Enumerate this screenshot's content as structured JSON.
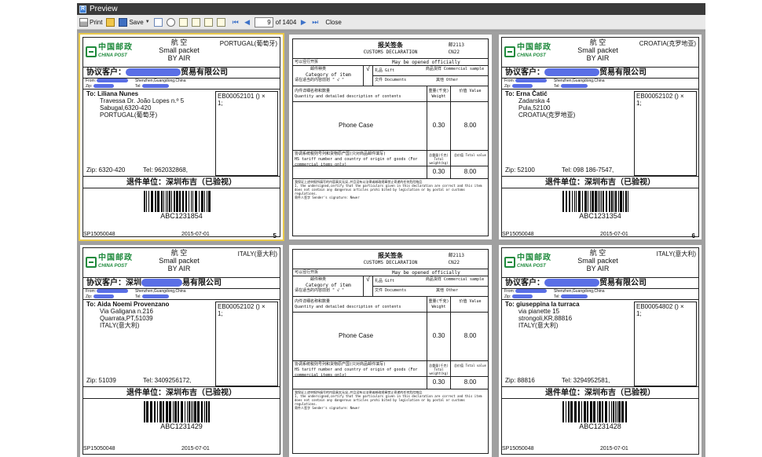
{
  "window": {
    "title": "Preview"
  },
  "toolbar": {
    "print_label": "Print",
    "save_label": "Save",
    "page_value": "9",
    "page_total": "of 1404",
    "close_label": "Close"
  },
  "labels": [
    {
      "header_cn": "航 空",
      "header_en1": "Small packet",
      "header_en2": "BY AIR",
      "logo_cn": "中国邮政",
      "logo_en": "CHINA POST",
      "destination_tag": "PORTUGAL(葡萄牙)",
      "customer_prefix": "协议客户：",
      "customer_suffix": "贸易有限公司",
      "from_label": "From:",
      "from_address": "Shenzhen,Guangdong,China",
      "zip_label_small": "Zip:",
      "tel_label_small": "Tel:",
      "to_label": "To:",
      "to_name": "Liliana Nunes",
      "to_line1": "Travessa Dr. João Lopes n.º 5",
      "to_line2": "Sabugal,6320-420",
      "to_line3": "PORTUGAL(葡萄牙)",
      "tracking": "EB00052101 () ×",
      "qty": "1;",
      "zip": "Zip:  6320-420",
      "tel": "Tel: 962032868,",
      "return_unit": "退件单位：深圳布吉（已验视）",
      "barcode_text": "ABC1231854",
      "sp_code": "SP15050048",
      "date": "2015-07-01",
      "page_number": "5"
    },
    {
      "header_cn": "航 空",
      "header_en1": "Small packet",
      "header_en2": "BY AIR",
      "logo_cn": "中国邮政",
      "logo_en": "CHINA POST",
      "destination_tag": "CROATIA(克罗地亚)",
      "customer_prefix": "协议客户：",
      "customer_suffix": "贸易有限公司",
      "from_label": "From:",
      "from_address": "Shenzhen,Guangdong,China",
      "zip_label_small": "Zip:",
      "tel_label_small": "Tel:",
      "to_label": "To:",
      "to_name": "Erna Čatić",
      "to_line1": "Zadarska 4",
      "to_line2": "Pula,52100",
      "to_line3": "CROATIA(克罗地亚)",
      "tracking": "EB00052102 () ×",
      "qty": "1;",
      "zip": "Zip:  52100",
      "tel": "Tel: 098 186-7547,",
      "return_unit": "退件单位：深圳布吉（已验视）",
      "barcode_text": "ABC1231354",
      "sp_code": "SP15050048",
      "date": "2015-07-01",
      "page_number": "6"
    },
    {
      "header_cn": "航 空",
      "header_en1": "Small packet",
      "header_en2": "BY AIR",
      "logo_cn": "中国邮政",
      "logo_en": "CHINA POST",
      "destination_tag": "ITALY(意大利)",
      "customer_prefix": "协议客户：深圳",
      "customer_suffix": "易有限公司",
      "from_label": "From:",
      "from_address": "Shenzhen,Guangdong,China",
      "zip_label_small": "Zip:",
      "tel_label_small": "Tel:",
      "to_label": "To:",
      "to_name": "Aida Noemi Provenzano",
      "to_line1": "Via Galigana n.216",
      "to_line2": "Quarrata,PT,51039",
      "to_line3": "ITALY(意大利)",
      "tracking": "EB00052102 () ×",
      "qty": "1;",
      "zip": "Zip:  51039",
      "tel": "Tel: 3409256172,",
      "return_unit": "退件单位：深圳布吉（已验视）",
      "barcode_text": "ABC1231429",
      "sp_code": "SP15050048",
      "date": "2015-07-01",
      "page_number": ""
    },
    {
      "header_cn": "航 空",
      "header_en1": "Small packet",
      "header_en2": "BY AIR",
      "logo_cn": "中国邮政",
      "logo_en": "CHINA POST",
      "destination_tag": "ITALY(意大利)",
      "customer_prefix": "协议客户：",
      "customer_suffix": "贸易有限公司",
      "from_label": "From:",
      "from_address": "Shenzhen,Guangdong,China",
      "zip_label_small": "Zip:",
      "tel_label_small": "Tel:",
      "to_label": "To:",
      "to_name": "giuseppina la turraca",
      "to_line1": "via pianette 15",
      "to_line2": "strongoli,KR,88816",
      "to_line3": "ITALY(意大利)",
      "tracking": "EB00054802 () ×",
      "qty": "1;",
      "zip": "Zip:  88816",
      "tel": "Tel: 3294952581,",
      "return_unit": "退件单位：深圳布吉（已验视）",
      "barcode_text": "ABC1231428",
      "sp_code": "SP15050048",
      "date": "2015-07-01",
      "page_number": ""
    }
  ],
  "customs": {
    "title_cn": "报关签条",
    "title_en": "CUSTOMS DECLARATION",
    "cn22_line1": "邮2113",
    "cn22_line2": "CN22",
    "open_cn": "可以径行开拆",
    "open_en": "May be opened officially",
    "category_cn": "邮件种类",
    "category_en": "Category of item",
    "category_hint": "请在适当的内容前划 \" √ \"",
    "check": "√",
    "gift": "礼品 Gift",
    "sample": "商品货样 Commercial sample",
    "documents": "文件 Documents",
    "other": "其他 Other",
    "contents_cn": "内件详细名称和数量",
    "contents_en": "Quantity and detailed description of contents",
    "weight_header": "重量(千克) Weight",
    "value_header": "价值 Value",
    "item": "Phone Case",
    "item_weight": "0.30",
    "item_value": "8.00",
    "hs_cn": "协调系统税则号列和货物原产国(只对商品邮件填写)",
    "hs_en": "HS tariff number and country of origin of goods (For commercial items only)",
    "total_weight_header": "总重量(千克) Total weight(kg)",
    "total_value_header": "总价值 Total value",
    "total_weight": "0.30",
    "total_value": "8.00",
    "declaration_cn": "我保证上述申报所填写的内容真实无误,并且没有以法律或邮政规章禁止寄递的任何危险物品",
    "declaration_en": "I, the undersigned,certify that the particulars given in this declaration are correct and this item does not contain any dangerous articles prohi bited by legislation or by postal or customs regulations.",
    "signature": "寄件人签字 Sender's signature: Newer"
  }
}
